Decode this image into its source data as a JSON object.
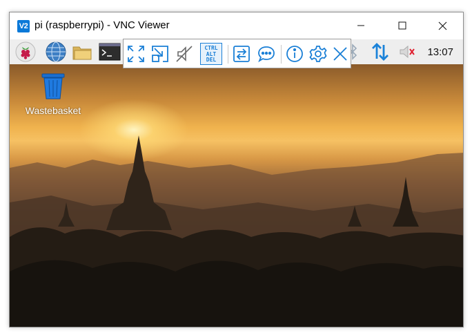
{
  "window": {
    "app_icon_text": "V2",
    "title": "pi (raspberrypi) - VNC Viewer",
    "controls": [
      "minimize",
      "maximize",
      "close"
    ]
  },
  "taskbar": {
    "launchers": [
      "raspberry-menu-icon",
      "web-browser-icon",
      "file-manager-icon",
      "terminal-icon"
    ],
    "tray": [
      "bluetooth-icon",
      "network-transfer-icon",
      "volume-muted-icon"
    ],
    "clock": "13:07"
  },
  "vnc_toolbar": {
    "buttons": [
      "fullscreen-icon",
      "scale-icon",
      "mute-audio-icon",
      "ctrl-alt-del",
      "file-transfer-icon",
      "chat-icon",
      "info-icon",
      "settings-icon",
      "disconnect-icon"
    ],
    "ctrl_alt_del": {
      "line1": "CTRL",
      "line2": "ALT",
      "line3": "DEL"
    },
    "accent": "#1a7fd6"
  },
  "desktop": {
    "icons": [
      {
        "label": "Wastebasket",
        "icon": "wastebasket-icon"
      }
    ]
  }
}
